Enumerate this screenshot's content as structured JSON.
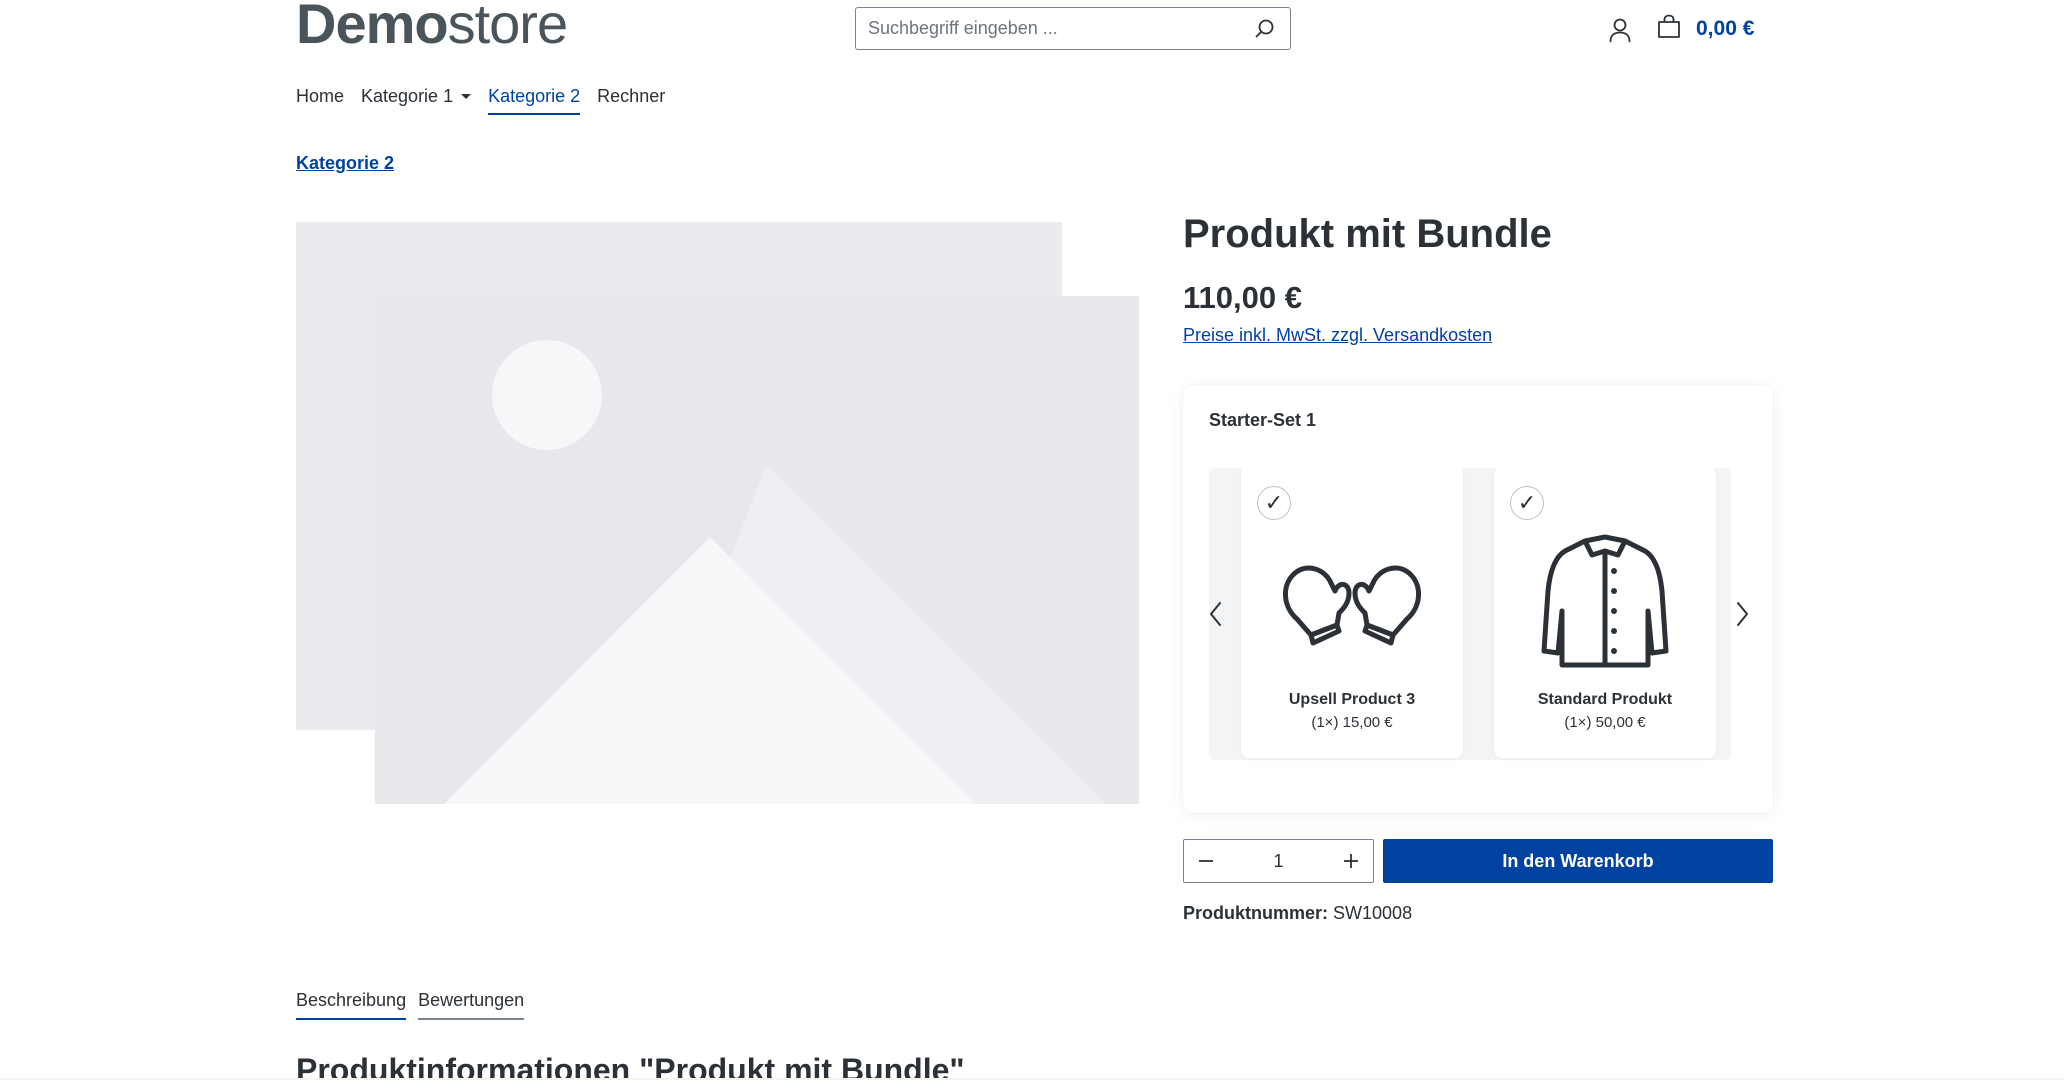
{
  "header": {
    "logo_bold": "Demo",
    "logo_light": "store",
    "search_placeholder": "Suchbegriff eingeben ...",
    "cart_total": "0,00 €"
  },
  "nav": {
    "items": [
      {
        "label": "Home"
      },
      {
        "label": "Kategorie 1"
      },
      {
        "label": "Kategorie 2"
      },
      {
        "label": "Rechner"
      }
    ]
  },
  "breadcrumb": "Kategorie 2",
  "product": {
    "title": "Produkt mit Bundle",
    "price": "110,00 €",
    "tax_note": "Preise inkl. MwSt. zzgl. Versandkosten",
    "quantity": "1",
    "add_to_cart": "In den Warenkorb",
    "number_label": "Produktnummer:",
    "number_value": "SW10008"
  },
  "bundle": {
    "title": "Starter-Set 1",
    "items": [
      {
        "name": "Upsell Product 3",
        "qty_price": "(1×) 15,00 €",
        "check": "✓",
        "icon": "mittens-icon"
      },
      {
        "name": "Standard Produkt",
        "qty_price": "(1×) 50,00 €",
        "check": "✓",
        "icon": "jacket-icon"
      }
    ]
  },
  "tabs": [
    {
      "label": "Beschreibung"
    },
    {
      "label": "Bewertungen"
    }
  ],
  "section_heading": "Produktinformationen \"Produkt mit Bundle\"",
  "colors": {
    "accent": "#0042a0",
    "text": "#2b3136",
    "placeholder_bg": "#e9eaed",
    "placeholder_fg": "#f6f7f9"
  }
}
